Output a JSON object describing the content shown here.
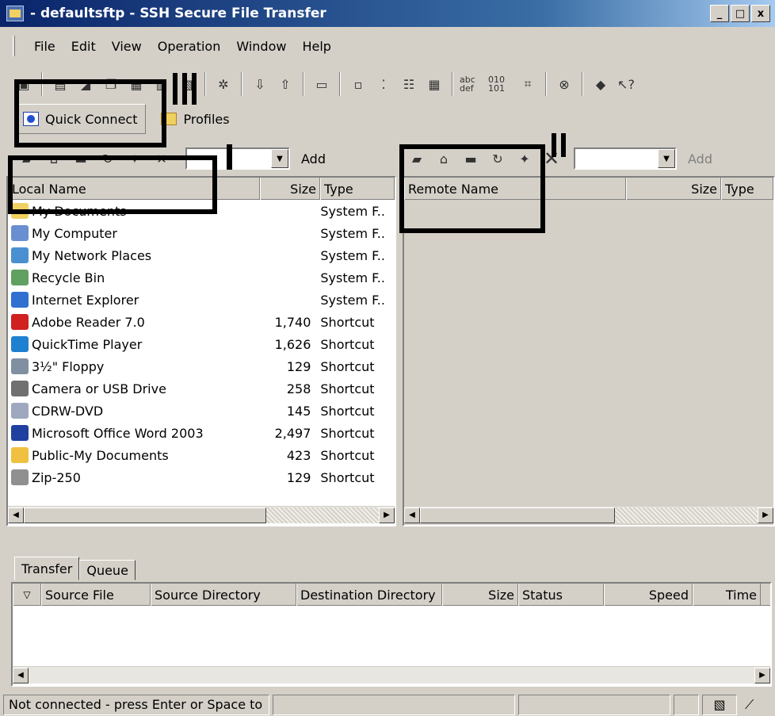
{
  "window": {
    "title": "- defaultsftp - SSH Secure File Transfer",
    "min": "_",
    "max": "□",
    "close": "x"
  },
  "menu": [
    "File",
    "Edit",
    "View",
    "Operation",
    "Window",
    "Help"
  ],
  "toolbar": {
    "quick_connect": "Quick Connect",
    "profiles": "Profiles",
    "abc_label": "abc def",
    "bin_label": "010 101"
  },
  "local": {
    "add_label": "Add",
    "headers": {
      "name": "Local Name",
      "size": "Size",
      "type": "Type"
    },
    "rows": [
      {
        "name": "My Documents",
        "size": "",
        "type": "System F..",
        "color": "#f0d060"
      },
      {
        "name": "My Computer",
        "size": "",
        "type": "System F..",
        "color": "#6a8fd0"
      },
      {
        "name": "My Network Places",
        "size": "",
        "type": "System F..",
        "color": "#4a90d0"
      },
      {
        "name": "Recycle Bin",
        "size": "",
        "type": "System F..",
        "color": "#60a060"
      },
      {
        "name": "Internet Explorer",
        "size": "",
        "type": "System F..",
        "color": "#3070d0"
      },
      {
        "name": "Adobe Reader 7.0",
        "size": "1,740",
        "type": "Shortcut",
        "color": "#d02020"
      },
      {
        "name": "QuickTime Player",
        "size": "1,626",
        "type": "Shortcut",
        "color": "#2080d0"
      },
      {
        "name": "3½\" Floppy",
        "size": "129",
        "type": "Shortcut",
        "color": "#8090a0"
      },
      {
        "name": "Camera or USB Drive",
        "size": "258",
        "type": "Shortcut",
        "color": "#707070"
      },
      {
        "name": "CDRW-DVD",
        "size": "145",
        "type": "Shortcut",
        "color": "#a0a8c0"
      },
      {
        "name": "Microsoft Office Word 2003",
        "size": "2,497",
        "type": "Shortcut",
        "color": "#2040a0"
      },
      {
        "name": "Public-My Documents",
        "size": "423",
        "type": "Shortcut",
        "color": "#f0c040"
      },
      {
        "name": "Zip-250",
        "size": "129",
        "type": "Shortcut",
        "color": "#909090"
      }
    ]
  },
  "remote": {
    "add_label": "Add",
    "headers": {
      "name": "Remote Name",
      "size": "Size",
      "type": "Type"
    }
  },
  "tabs": [
    "Transfer",
    "Queue"
  ],
  "transfer_headers": [
    "Source File",
    "Source Directory",
    "Destination Directory",
    "Size",
    "Status",
    "Speed",
    "Time"
  ],
  "status": {
    "text": "Not connected - press Enter or Space to"
  }
}
